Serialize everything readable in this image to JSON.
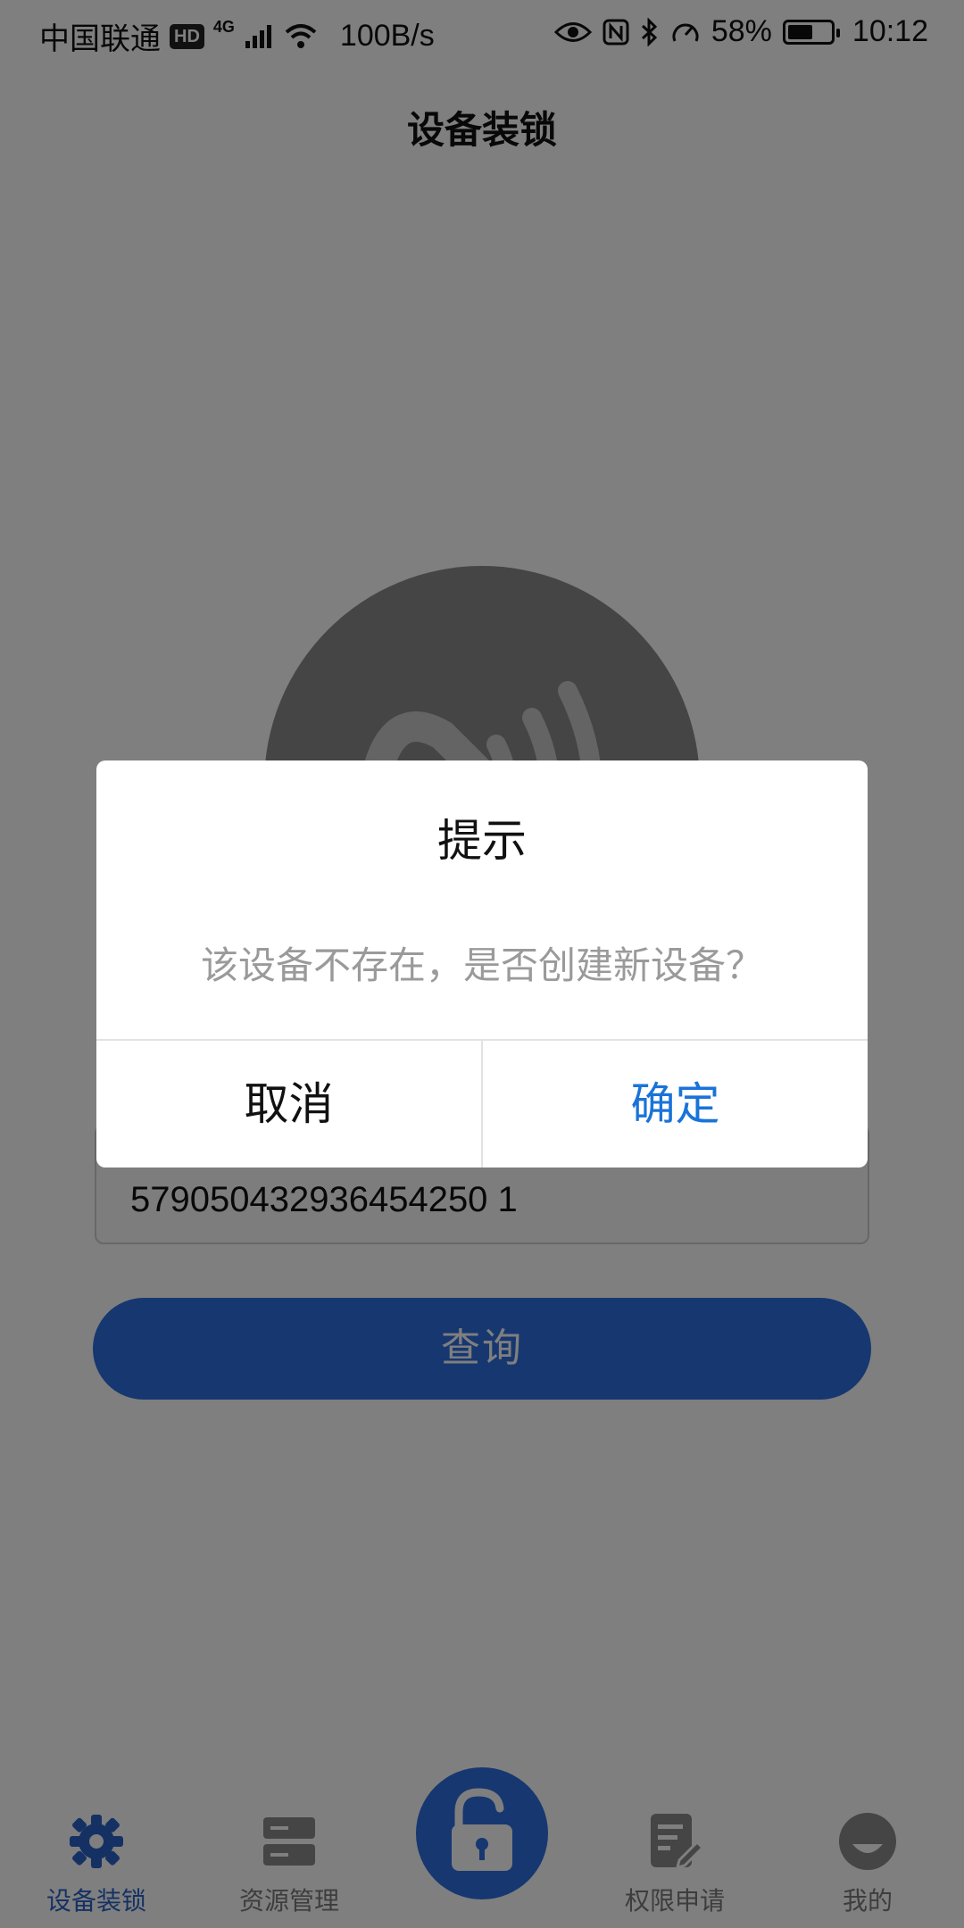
{
  "status_bar": {
    "carrier": "中国联通",
    "hd_badge": "HD",
    "network_type": "4G",
    "speed": "100B/s",
    "battery_percent": "58%",
    "battery_level": 0.58,
    "time": "10:12"
  },
  "header": {
    "title": "设备装锁"
  },
  "main": {
    "device_id": "579050432936454250 1",
    "query_label": "查询"
  },
  "dialog": {
    "title": "提示",
    "message": "该设备不存在，是否创建新设备？",
    "cancel_label": "取消",
    "confirm_label": "确定"
  },
  "bottom_nav": {
    "items": [
      {
        "label": "设备装锁",
        "icon": "gear-icon",
        "active": true
      },
      {
        "label": "资源管理",
        "icon": "server-icon",
        "active": false
      },
      {
        "label": "",
        "icon": "unlock-icon",
        "active": false
      },
      {
        "label": "权限申请",
        "icon": "edit-document-icon",
        "active": false
      },
      {
        "label": "我的",
        "icon": "profile-icon",
        "active": false
      }
    ]
  },
  "colors": {
    "accent": "#2f6fe0",
    "active_nav": "#2b63c8",
    "confirm": "#1a73d8",
    "overlay": "rgba(0,0,0,0.5)"
  }
}
